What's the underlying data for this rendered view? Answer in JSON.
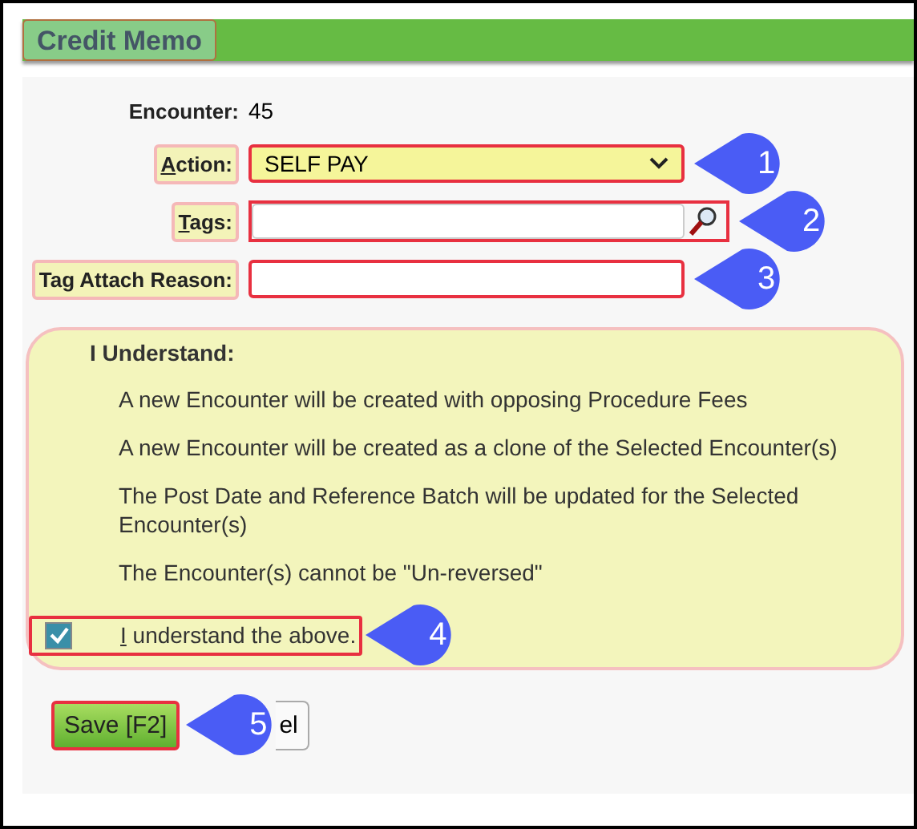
{
  "title": "Credit Memo",
  "encounter": {
    "label": "Encounter:",
    "value": "45"
  },
  "fields": [
    {
      "kind": "select",
      "label_key": "A",
      "label_rest": "ction:",
      "value": "SELF PAY",
      "callout": "1"
    },
    {
      "kind": "search",
      "label_key": "T",
      "label_rest": "ags:",
      "callout": "2"
    },
    {
      "kind": "text",
      "label_rest": "Tag Attach Reason:",
      "callout": "3"
    }
  ],
  "understand": {
    "heading": "I Understand:",
    "items": [
      "A new Encounter will be created with opposing Procedure Fees",
      "A new Encounter will be created as a clone of the Selected Encounter(s)",
      "The Post Date and Reference Batch will be updated for the Selected Encounter(s)",
      "The Encounter(s) cannot be \"Un-reversed\""
    ],
    "checkbox": {
      "label_key": "I",
      "label_rest": " understand the above.",
      "checked": true,
      "callout": "4"
    }
  },
  "buttons": [
    {
      "kind": "save",
      "label": "Save [F2]",
      "callout": "5"
    },
    {
      "kind": "cancel",
      "label": "el"
    }
  ]
}
